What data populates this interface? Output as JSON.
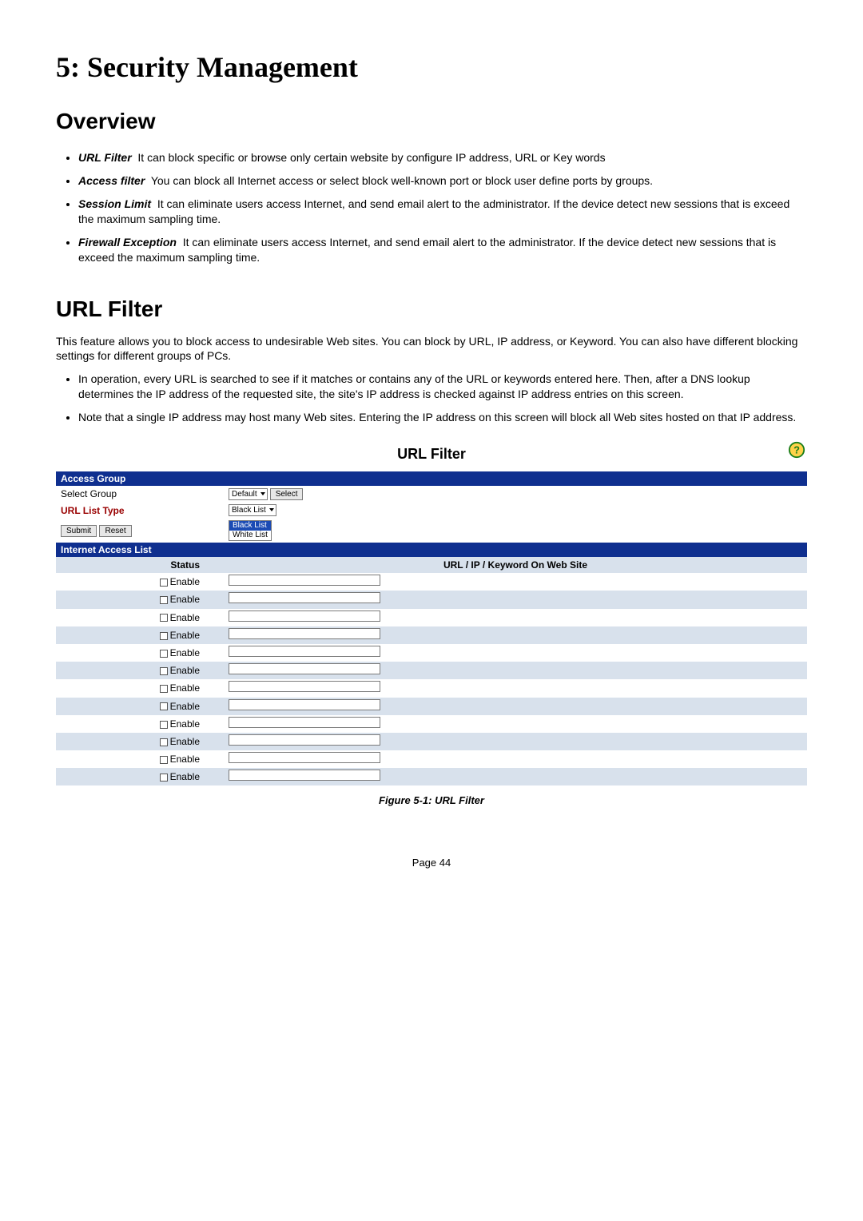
{
  "chapter_title": "5: Security Management",
  "overview": {
    "heading": "Overview",
    "items": [
      {
        "name": "URL Filter",
        "desc": "It can block specific or  browse only certain website by configure IP address, URL or Key words"
      },
      {
        "name": "Access filter",
        "desc": "You can block all Internet access or select block well-known port or block user define ports by groups."
      },
      {
        "name": "Session Limit",
        "desc": "It can eliminate users access Internet, and send email alert to the administrator. If the device detect  new sessions that is exceed the maximum sampling time."
      },
      {
        "name": "Firewall Exception",
        "desc": "It can eliminate users access Internet, and send email alert to the administrator. If the device detect new sessions that is exceed the maximum sampling time."
      }
    ]
  },
  "url_filter_section": {
    "heading": " URL Filter",
    "intro": "This feature allows you to block access to undesirable Web sites. You can block by URL, IP address, or Keyword.  You can also have different blocking settings for different groups of PCs.",
    "bullets": [
      "In operation, every URL is searched to see if it matches or contains any of the URL or keywords entered here. Then, after a DNS lookup determines the IP address of the requested site, the site's IP address is checked against IP address entries on this screen.",
      "Note that a single IP address may host many Web sites. Entering the IP address on this screen will block all Web sites hosted on that IP address."
    ]
  },
  "figure": {
    "title": "URL Filter",
    "access_group_header": "Access Group",
    "select_group_label": "Select Group",
    "select_group_value": "Default",
    "select_button": "Select",
    "url_list_type_label": "URL List Type",
    "url_list_type_value": "Black List",
    "url_list_type_options": [
      "Black List",
      "White List"
    ],
    "submit": "Submit",
    "reset": "Reset",
    "internet_access_header": "Internet Access List",
    "col_status": "Status",
    "col_url": "URL / IP / Keyword On Web Site",
    "enable_label": "Enable",
    "row_count": 12,
    "caption": "Figure 5-1:  URL Filter"
  },
  "page_number": "Page 44"
}
